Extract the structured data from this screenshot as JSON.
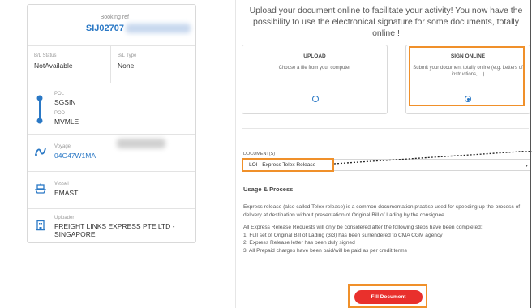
{
  "shipment": {
    "booking_label": "Booking ref",
    "booking_value": "SIJ02707",
    "bl_status_label": "B/L Status",
    "bl_status_value": "NotAvailable",
    "bl_type_label": "B/L Type",
    "bl_type_value": "None",
    "pol_label": "POL",
    "pol_value": "SGSIN",
    "pod_label": "POD",
    "pod_value": "MVMLE",
    "voyage_label": "Voyage",
    "voyage_value": "04G47W1MA",
    "vessel_label": "Vessel",
    "vessel_value": "EMAST",
    "uploader_label": "Uploader",
    "uploader_value": "FREIGHT LINKS EXPRESS PTE LTD - SINGAPORE"
  },
  "upload": {
    "heading": "Upload your document online to facilitate your activity! You now have the possibility to use the electronical signature for some documents, totally online !",
    "option_upload_title": "UPLOAD",
    "option_upload_desc": "Choose a file from your computer",
    "option_sign_title": "SIGN ONLINE",
    "option_sign_desc": "Submit your document totally online (e.g. Letters of instructions, ...)",
    "selected_option": "sign_online",
    "document_label": "DOCUMENT(S)",
    "document_value": "LOI - Express Telex Release",
    "usage_title": "Usage & Process",
    "usage_p1": "Express release (also called Telex release) is a common documentation practise used for speeding up the process of delivery at destination without presentation of Original Bill of Lading by the consignee.",
    "usage_p2_intro": "All Express Release Requests will only be considered after the following steps have been completed:",
    "usage_step1": "1. Full set of Original Bill of Lading (3/3) has been surrendered to CMA CGM agency",
    "usage_step2": "2. Express Release letter has been duly signed",
    "usage_step3": "3. All Prepaid charges have been paid/will be paid as per credit terms",
    "fill_button": "Fill Document"
  },
  "colors": {
    "accent_blue": "#2a78c5",
    "highlight_orange": "#f0902a",
    "button_red": "#e9302c"
  }
}
